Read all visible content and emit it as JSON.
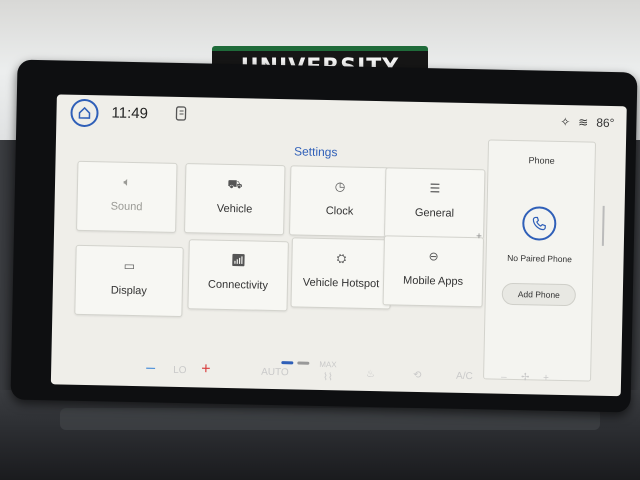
{
  "sign": {
    "text": "UNIVERSITY"
  },
  "status": {
    "time": "11:49",
    "temperature": "86°"
  },
  "settings": {
    "title": "Settings",
    "tiles": [
      {
        "label": "Sound",
        "icon": "speaker-icon",
        "dimmed": true
      },
      {
        "label": "Vehicle",
        "icon": "vehicle-icon"
      },
      {
        "label": "Clock",
        "icon": "clock-icon"
      },
      {
        "label": "General",
        "icon": "sliders-icon"
      },
      {
        "label": "Display",
        "icon": "display-icon"
      },
      {
        "label": "Connectivity",
        "icon": "wifi-icon"
      },
      {
        "label": "Vehicle Hotspot",
        "icon": "hotspot-icon"
      },
      {
        "label": "Mobile Apps",
        "icon": "apps-icon"
      }
    ]
  },
  "phone": {
    "title": "Phone",
    "status": "No Paired Phone",
    "add_button": "Add Phone"
  },
  "climate": {
    "temp_left": "LO",
    "auto": "AUTO",
    "max_defrost": "MAX",
    "ac": "A/C"
  }
}
